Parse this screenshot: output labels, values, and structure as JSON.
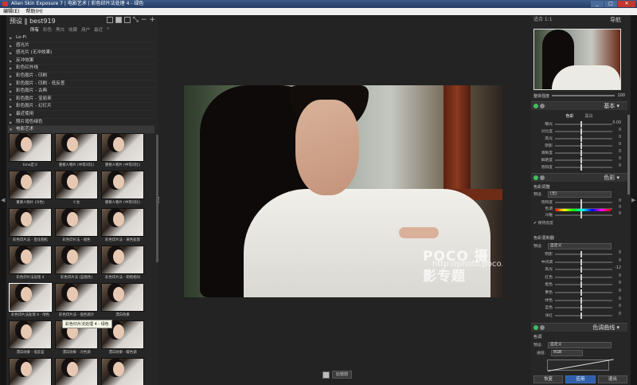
{
  "window": {
    "title": "Alien Skin Exposure 7 | 电影艺术 | 彩色印片法处理 4 - 绿色",
    "controls": [
      "_",
      "□",
      "✕"
    ]
  },
  "menu": [
    "编辑(E)",
    "帮助(H)"
  ],
  "left_panel": {
    "header": "预设 ‖ best919",
    "filter_tabs": [
      "所有",
      "彩色",
      "黑白",
      "收藏",
      "用户",
      "最近"
    ],
    "tree": [
      {
        "label": "Lo-Fi",
        "open": false
      },
      {
        "label": "感光片",
        "open": false
      },
      {
        "label": "感光片 (无冲效果)",
        "open": false
      },
      {
        "label": "反冲效果",
        "open": false
      },
      {
        "label": "彩色红外线",
        "open": false
      },
      {
        "label": "彩色胶片 - 印刷",
        "open": false
      },
      {
        "label": "彩色胶片 - 印刷 - 低反差",
        "open": false
      },
      {
        "label": "彩色胶片 - 古典",
        "open": false
      },
      {
        "label": "彩色胶片 - 宝丽来",
        "open": false
      },
      {
        "label": "彩色胶片 - 幻灯片",
        "open": false
      },
      {
        "label": "最近使用",
        "open": false
      },
      {
        "label": "照片增色绿色",
        "open": false
      },
      {
        "label": "电影艺术",
        "open": true
      }
    ],
    "thumbnails": [
      "time定义",
      "重要人物片 (中等对比)",
      "重要人物片 (中等对比)",
      "重要人物片 (冷色)",
      "少女",
      "重要人物片 (中等对比)",
      "彩色印片法 - 变化相机",
      "彩色印片法 - 褪色",
      "彩色印片法 - 黄色处理",
      "彩色印片法处理 4",
      "彩色印片法 (蓝图色)",
      "彩色印片法 - 明暗相间",
      "彩色印片法处理 4 - 绿色",
      "彩色印片法 - 低色调冷",
      "漂白效果",
      "漂白效果 - 低反差",
      "漂白效果 - 冷色调",
      "漂白效果 - 暖色调",
      "漂白效果 - 蓝色",
      "漂白效果 - 增色",
      "漂白效果 - 褪色"
    ],
    "tooltip": "彩色印片法处理 4 - 绿色"
  },
  "center": {
    "watermark": "POCO 摄影专题",
    "watermark_url": "http://photo.poco.cn/",
    "compare_button": "比较前"
  },
  "right_panel": {
    "zoom": "适合  1:1",
    "navigator_title": "导航",
    "opacity_label": "整体强度",
    "opacity_value": "100",
    "basic": {
      "title": "基本",
      "tabs": [
        "色彩",
        "黑白"
      ],
      "sliders": [
        {
          "name": "曝光",
          "value": "0.00"
        },
        {
          "name": "对比度",
          "value": "0"
        },
        {
          "name": "高光",
          "value": "0"
        },
        {
          "name": "阴影",
          "value": "0"
        },
        {
          "name": "清晰度",
          "value": "0"
        },
        {
          "name": "鲜艳度",
          "value": "0"
        },
        {
          "name": "饱和度",
          "value": "0"
        }
      ]
    },
    "color": {
      "title": "色彩",
      "sub1": "色彩调整",
      "preset_label": "预设:",
      "preset_value": "(无)",
      "sliders1": [
        {
          "name": "饱和度",
          "value": "0"
        },
        {
          "name": "色调",
          "value": "0"
        },
        {
          "name": "冷暖",
          "value": "0"
        }
      ],
      "checkbox": "保持亮度",
      "sub2": "色彩混和器",
      "preset2_value": "自定义",
      "sliders2": [
        {
          "name": "阴影",
          "value": "0"
        },
        {
          "name": "中间调",
          "value": "0"
        },
        {
          "name": "高光",
          "value": "-12"
        },
        {
          "name": "红色",
          "value": "0"
        },
        {
          "name": "橙色",
          "value": "0"
        },
        {
          "name": "黄色",
          "value": "0"
        },
        {
          "name": "绿色",
          "value": "0"
        },
        {
          "name": "蓝色",
          "value": "0"
        },
        {
          "name": "洋红",
          "value": "0"
        }
      ]
    },
    "curves": {
      "title": "色调曲线",
      "sub": "色调",
      "preset_value": "自定义",
      "channel_label": "通道:",
      "channel_value": "RGB"
    },
    "footer": [
      "恢复",
      "应用",
      "退出"
    ]
  }
}
